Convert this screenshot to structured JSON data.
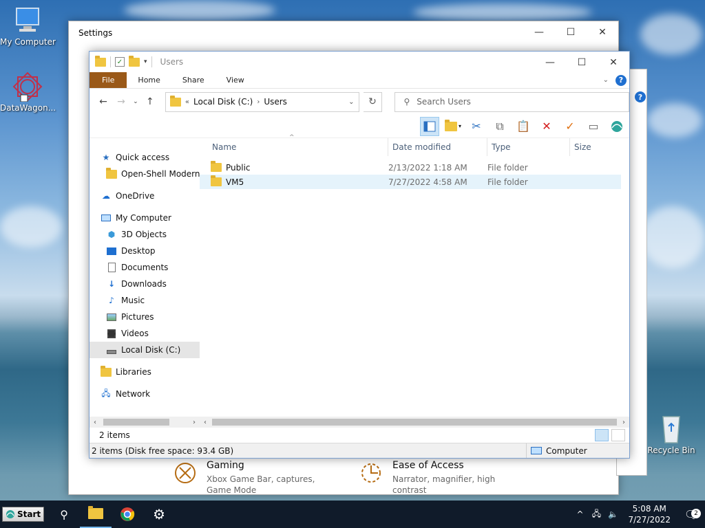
{
  "desktop": {
    "icons": [
      {
        "label": "My Computer"
      },
      {
        "label": "DataWagon..."
      },
      {
        "label": "Recycle Bin"
      }
    ]
  },
  "settings": {
    "title": "Settings",
    "tiles": [
      {
        "name": "Gaming",
        "desc": "Xbox Game Bar, captures, Game Mode"
      },
      {
        "name": "Ease of Access",
        "desc": "Narrator, magnifier, high contrast"
      }
    ]
  },
  "explorer": {
    "title": "Users",
    "ribbon_tabs": [
      "File",
      "Home",
      "Share",
      "View"
    ],
    "address": {
      "prefix": "«",
      "crumbs": [
        "Local Disk (C:)",
        "Users"
      ]
    },
    "search_placeholder": "Search Users",
    "nav": {
      "quick_access": "Quick access",
      "pinned": "Open-Shell Modern S",
      "onedrive": "OneDrive",
      "my_computer": "My Computer",
      "objects3d": "3D Objects",
      "desktop": "Desktop",
      "documents": "Documents",
      "downloads": "Downloads",
      "music": "Music",
      "pictures": "Pictures",
      "videos": "Videos",
      "local_disk": "Local Disk (C:)",
      "libraries": "Libraries",
      "network": "Network"
    },
    "columns": [
      "Name",
      "Date modified",
      "Type",
      "Size"
    ],
    "files": [
      {
        "name": "Public",
        "date": "2/13/2022 1:18 AM",
        "type": "File folder"
      },
      {
        "name": "VM5",
        "date": "7/27/2022 4:58 AM",
        "type": "File folder"
      }
    ],
    "item_count": "2 items",
    "status_detail": "2 items (Disk free space: 93.4 GB)",
    "zone": "Computer"
  },
  "taskbar": {
    "start_label": "Start",
    "time": "5:08 AM",
    "date": "7/27/2022",
    "notification_count": "2"
  }
}
